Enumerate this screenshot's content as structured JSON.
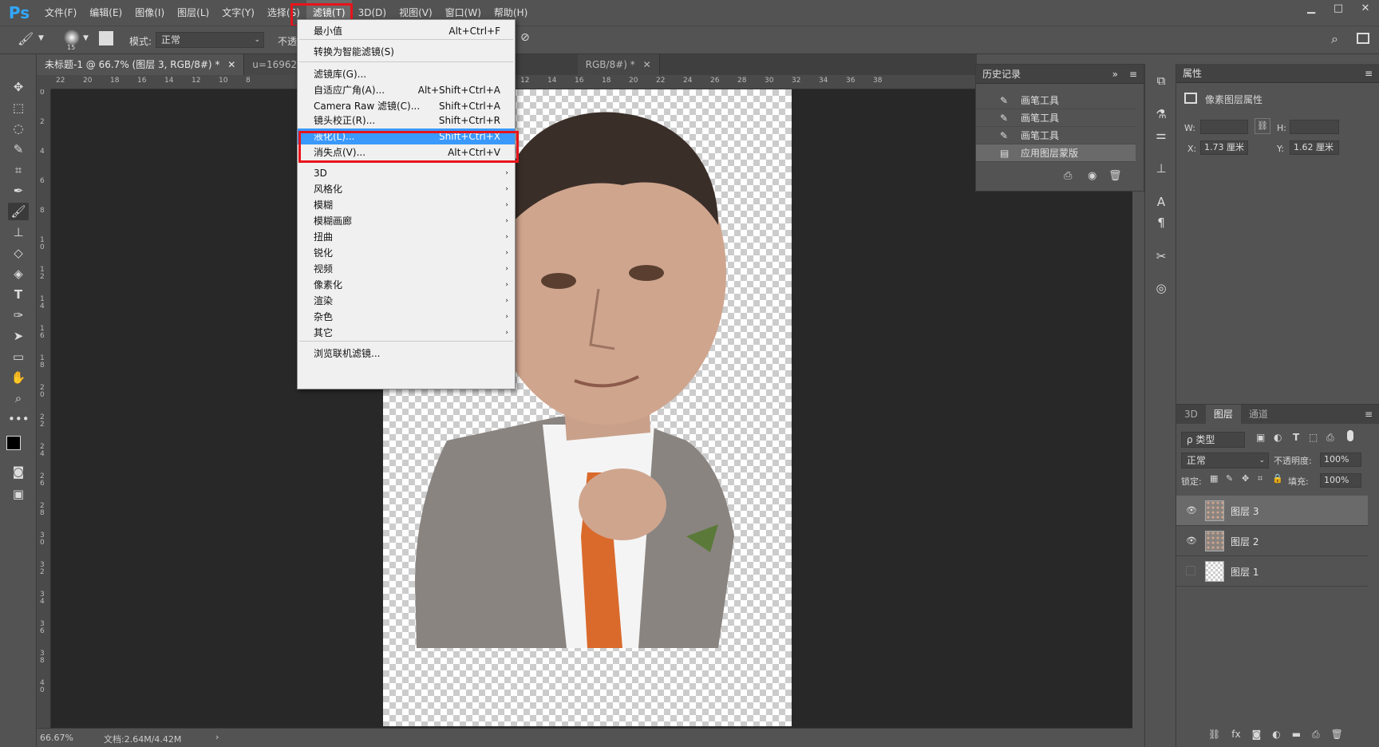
{
  "app": {
    "logo": "Ps"
  },
  "menubar": {
    "items": [
      "文件(F)",
      "编辑(E)",
      "图像(I)",
      "图层(L)",
      "文字(Y)",
      "选择(S)",
      "滤镜(T)",
      "3D(D)",
      "视图(V)",
      "窗口(W)",
      "帮助(H)"
    ],
    "active": "滤镜(T)"
  },
  "window_controls": {
    "minimize": "▁",
    "restore": "□",
    "close": "✕"
  },
  "options": {
    "brush_size": "15",
    "mode_label": "模式:",
    "mode_value": "正常",
    "opacity_label": "不透"
  },
  "tabs": [
    {
      "label": "未标题-1 @ 66.7% (图层 3, RGB/8#) *",
      "close": "✕"
    },
    {
      "label": "u=169623659"
    },
    {
      "label": "RGB/8#) *",
      "close": "✕"
    }
  ],
  "ruler_h": [
    "22",
    "20",
    "18",
    "16",
    "14",
    "12",
    "10",
    "8",
    "10",
    "12",
    "14",
    "16",
    "18",
    "20",
    "22",
    "24",
    "26",
    "28",
    "30",
    "32",
    "34",
    "36",
    "38"
  ],
  "ruler_v": [
    "0",
    "2",
    "4",
    "6",
    "8",
    "1 0",
    "1 2",
    "1 4",
    "1 6",
    "1 8",
    "2 0",
    "2 2",
    "2 4",
    "2 6",
    "2 8",
    "3 0",
    "3 2",
    "3 4",
    "3 6",
    "3 8",
    "4 0"
  ],
  "filter_menu": {
    "items": [
      {
        "label": "最小值",
        "shortcut": "Alt+Ctrl+F"
      },
      {
        "label": "转换为智能滤镜(S)",
        "shortcut": ""
      },
      {
        "label": "滤镜库(G)...",
        "shortcut": ""
      },
      {
        "label": "自适应广角(A)...",
        "shortcut": "Alt+Shift+Ctrl+A"
      },
      {
        "label": "Camera Raw 滤镜(C)...",
        "shortcut": "Shift+Ctrl+A"
      },
      {
        "label": "镜头校正(R)...",
        "shortcut": "Shift+Ctrl+R"
      },
      {
        "label": "液化(L)...",
        "shortcut": "Shift+Ctrl+X"
      },
      {
        "label": "消失点(V)...",
        "shortcut": "Alt+Ctrl+V"
      },
      {
        "label": "3D",
        "shortcut": ""
      },
      {
        "label": "风格化",
        "shortcut": ""
      },
      {
        "label": "模糊",
        "shortcut": ""
      },
      {
        "label": "模糊画廊",
        "shortcut": ""
      },
      {
        "label": "扭曲",
        "shortcut": ""
      },
      {
        "label": "锐化",
        "shortcut": ""
      },
      {
        "label": "视频",
        "shortcut": ""
      },
      {
        "label": "像素化",
        "shortcut": ""
      },
      {
        "label": "渲染",
        "shortcut": ""
      },
      {
        "label": "杂色",
        "shortcut": ""
      },
      {
        "label": "其它",
        "shortcut": ""
      },
      {
        "label": "浏览联机滤镜...",
        "shortcut": ""
      }
    ],
    "submenu_arrow": "›",
    "highlighted": "液化(L)..."
  },
  "history": {
    "title": "历史记录",
    "items": [
      "画笔工具",
      "画笔工具",
      "画笔工具",
      "应用图层蒙版"
    ],
    "expand": "»"
  },
  "properties": {
    "title": "属性",
    "subtitle": "像素图层属性",
    "w_label": "W:",
    "h_label": "H:",
    "x_label": "X:",
    "x_value": "1.73 厘米",
    "y_label": "Y:",
    "y_value": "1.62 厘米"
  },
  "layers_panel": {
    "tabs": [
      "3D",
      "图层",
      "通道"
    ],
    "active_tab": "图层",
    "filter_label": "ρ 类型",
    "blend_mode": "正常",
    "opacity_label": "不透明度:",
    "opacity_value": "100%",
    "lock_label": "锁定:",
    "fill_label": "填充:",
    "fill_value": "100%",
    "layers": [
      {
        "name": "图层 3",
        "visible": true
      },
      {
        "name": "图层 2",
        "visible": true
      },
      {
        "name": "图层 1",
        "visible": false
      }
    ]
  },
  "status": {
    "zoom": "66.67%",
    "doc": "文档:2.64M/4.42M",
    "arrow": "›"
  },
  "colors": {
    "highlight": "#3b99fc",
    "red_box": "#e8141b",
    "ps_blue": "#31a8ff"
  }
}
